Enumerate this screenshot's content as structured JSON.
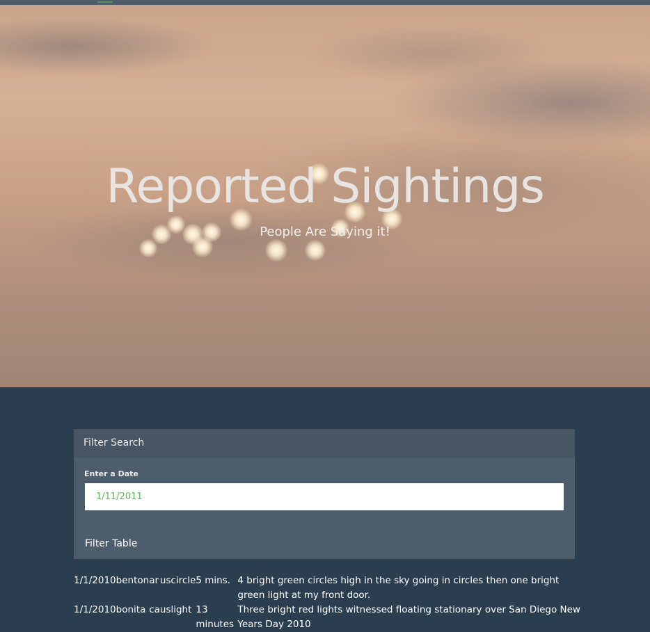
{
  "hero": {
    "title": "Reported Sightings",
    "subtitle": "People Are Saying it!"
  },
  "filter_panel": {
    "heading": "Filter Search",
    "date_label": "Enter a Date",
    "date_placeholder": "1/11/2011",
    "filter_button_label": "Filter Table"
  },
  "table": {
    "rows": [
      {
        "datetime": "1/1/2010",
        "city": "benton",
        "state": "ar",
        "country": "us",
        "shape": "circle",
        "duration": "5 mins.",
        "comments": "4 bright green circles high in the sky going in circles then one bright green light at my front door."
      },
      {
        "datetime": "1/1/2010",
        "city": "bonita",
        "state": "ca",
        "country": "us",
        "shape": "light",
        "duration": "13 minutes",
        "comments": "Three bright red lights witnessed floating stationary over San Diego New Years Day 2010"
      }
    ]
  },
  "colors": {
    "page_background": "#2b3e50",
    "panel_background": "#4e5d6c",
    "panel_heading": "#485563",
    "placeholder_accent": "#5cb85c"
  }
}
